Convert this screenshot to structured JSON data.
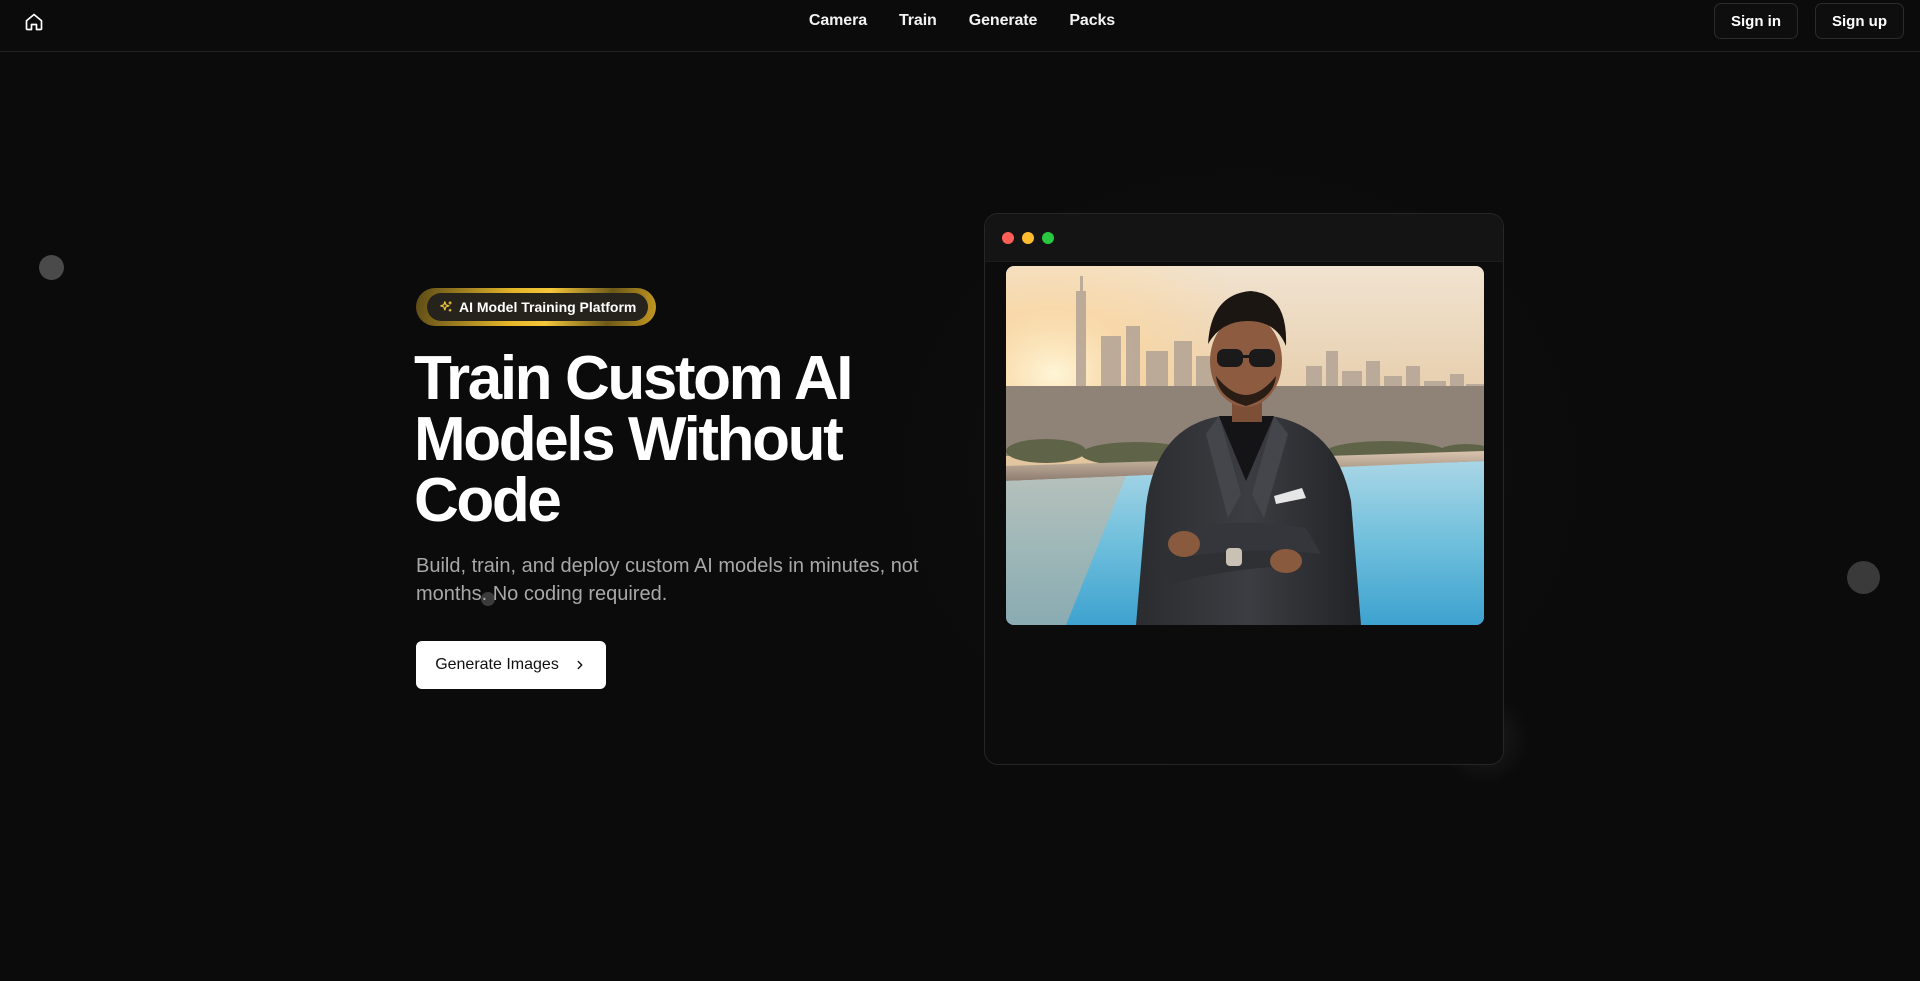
{
  "nav": {
    "home_icon": "home-icon",
    "links": [
      "Camera",
      "Train",
      "Generate",
      "Packs"
    ],
    "sign_in": "Sign in",
    "sign_up": "Sign up"
  },
  "hero": {
    "badge_icon": "sparkles-icon",
    "badge": "AI Model Training Platform",
    "title_lines": [
      "Train Custom AI",
      "Models Without",
      "Code"
    ],
    "subtitle": "Build, train, and deploy custom AI models in minutes, not months. No coding required.",
    "cta_label": "Generate Images",
    "cta_icon": "chevron-right-icon"
  },
  "preview": {
    "window_controls": [
      "close",
      "minimize",
      "maximize"
    ],
    "image": "generated-portrait-image"
  },
  "colors": {
    "background": "#0b0b0b",
    "badge_gold": "#f4c63a",
    "traffic_red": "#ff5f57",
    "traffic_yellow": "#febc2e",
    "traffic_green": "#28c840"
  }
}
